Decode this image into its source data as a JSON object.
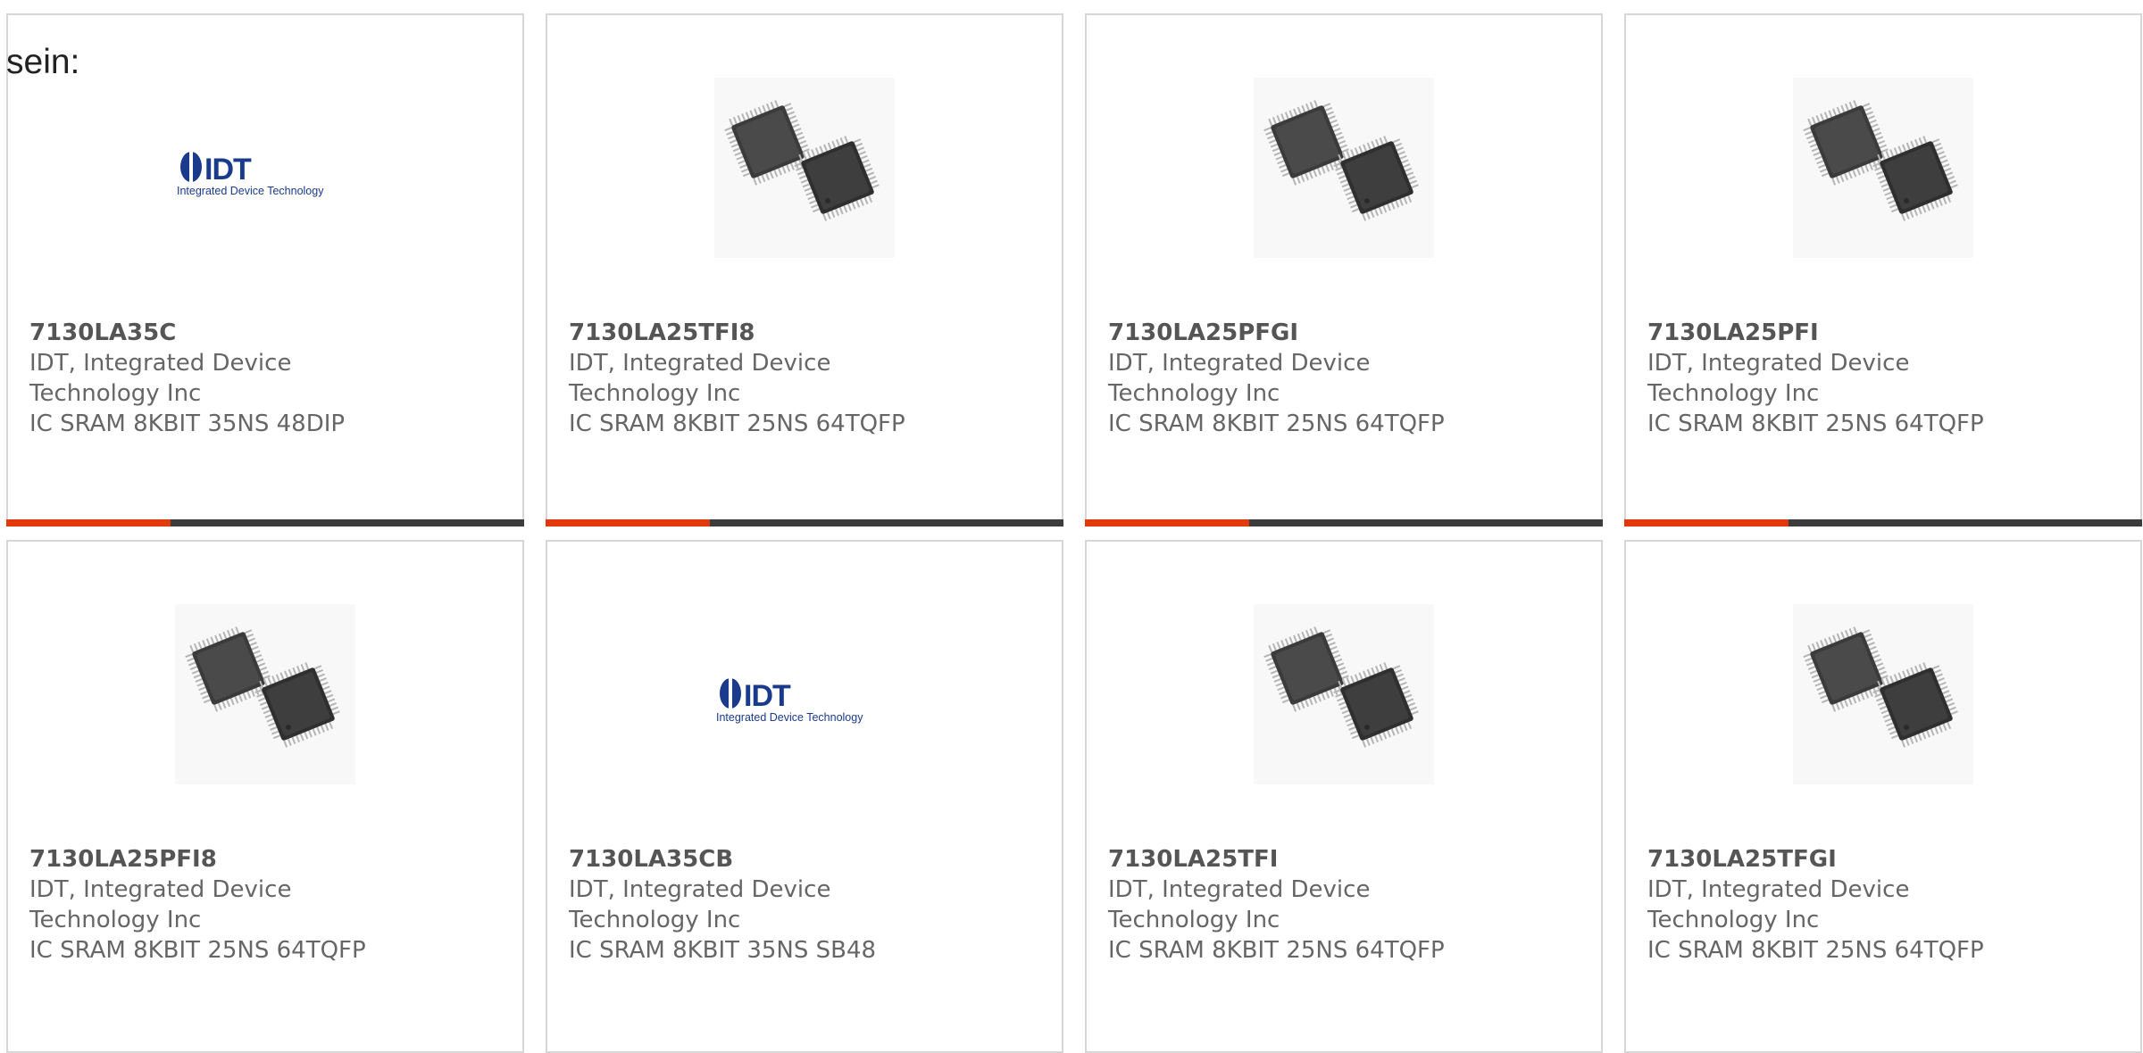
{
  "intro": "sein:",
  "products": [
    {
      "part_number": "7130LA35C",
      "manufacturer": "IDT, Integrated Device Technology Inc",
      "description": "IC SRAM 8KBIT 35NS 48DIP",
      "image": "idt-logo",
      "logo_letters": "IDT",
      "logo_tagline": "Integrated Device Technology",
      "logo_color": "#1a3a8c"
    },
    {
      "part_number": "7130LA25TFI8",
      "manufacturer": "IDT, Integrated Device Technology Inc",
      "description": "IC SRAM 8KBIT 25NS 64TQFP",
      "image": "tqfp-chips-photo"
    },
    {
      "part_number": "7130LA25PFGI",
      "manufacturer": "IDT, Integrated Device Technology Inc",
      "description": "IC SRAM 8KBIT 25NS 64TQFP",
      "image": "tqfp-chips-photo"
    },
    {
      "part_number": "7130LA25PFI",
      "manufacturer": "IDT, Integrated Device Technology Inc",
      "description": "IC SRAM 8KBIT 25NS 64TQFP",
      "image": "tqfp-chips-photo"
    },
    {
      "part_number": "7130LA25PFI8",
      "manufacturer": "IDT, Integrated Device Technology Inc",
      "description": "IC SRAM 8KBIT 25NS 64TQFP",
      "image": "tqfp-chips-photo"
    },
    {
      "part_number": "7130LA35CB",
      "manufacturer": "IDT, Integrated Device Technology Inc",
      "description": "IC SRAM 8KBIT 35NS SB48",
      "image": "idt-logo",
      "logo_letters": "IDT",
      "logo_tagline": "Integrated Device Technology",
      "logo_color": "#1a3a8c"
    },
    {
      "part_number": "7130LA25TFI",
      "manufacturer": "IDT, Integrated Device Technology Inc",
      "description": "IC SRAM 8KBIT 25NS 64TQFP",
      "image": "tqfp-chips-photo"
    },
    {
      "part_number": "7130LA25TFGI",
      "manufacturer": "IDT, Integrated Device Technology Inc",
      "description": "IC SRAM 8KBIT 25NS 64TQFP",
      "image": "tqfp-chips-photo"
    }
  ],
  "colors": {
    "accent": "#e03a0c",
    "bar": "#3c3c3c",
    "card_border": "#d7d7d7",
    "text": "#666666"
  }
}
